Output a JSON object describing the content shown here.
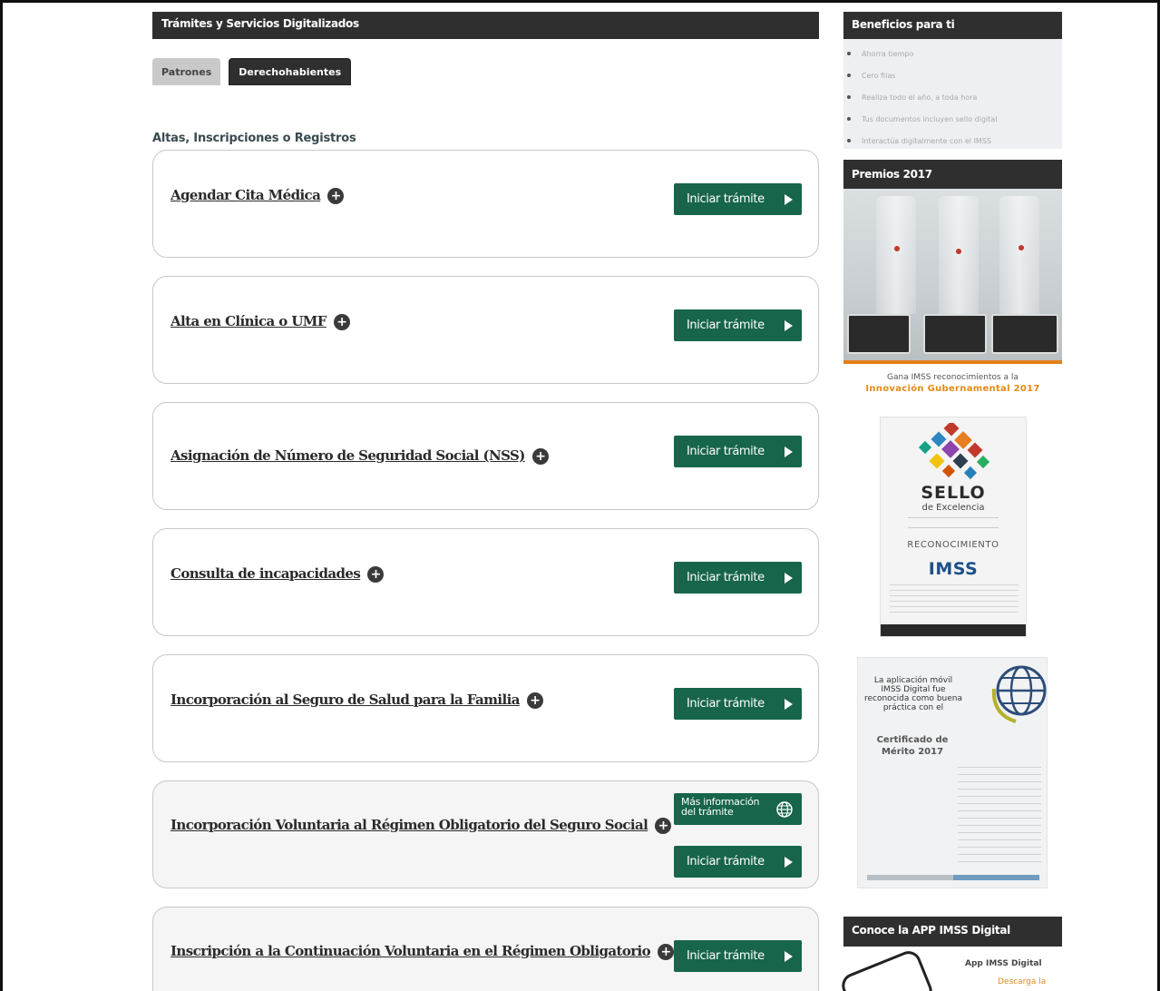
{
  "main": {
    "header": "Trámites y Servicios Digitalizados",
    "tabs": [
      {
        "label": "Patrones",
        "active": false
      },
      {
        "label": "Derechohabientes",
        "active": true
      }
    ],
    "section_title": "Altas, Inscripciones o Registros",
    "cards": [
      {
        "title": "Agendar Cita Médica",
        "button": "Iniciar trámite"
      },
      {
        "title": "Alta en Clínica o UMF",
        "button": "Iniciar trámite"
      },
      {
        "title": "Asignación de Número de Seguridad Social (NSS)",
        "button": "Iniciar trámite"
      },
      {
        "title": "Consulta de incapacidades",
        "button": "Iniciar trámite"
      },
      {
        "title": "Incorporación al Seguro de Salud para la Familia",
        "button": "Iniciar trámite"
      },
      {
        "title": "Incorporación Voluntaria al Régimen Obligatorio del Seguro Social",
        "info_button": "Más información del trámite",
        "button": "Iniciar trámite"
      },
      {
        "title": "Inscripción a la Continuación Voluntaria en el Régimen Obligatorio",
        "button": "Iniciar trámite"
      }
    ],
    "accent_color": "#17654a"
  },
  "sidebar": {
    "benefits_header": "Beneficios para ti",
    "benefits": [
      "Ahorra tiempo",
      "Cero filas",
      "Realiza todo el año, a toda hora",
      "Tus documentos incluyen sello digital",
      "Interactúa digitalmente con el IMSS"
    ],
    "awards_header": "Premios 2017",
    "awards_caption": "Gana IMSS reconocimientos a la",
    "awards_caption_highlight": "Innovación Gubernamental 2017",
    "sello_title": "SELLO",
    "sello_subtitle": "de Excelencia",
    "sello_recognition": "RECONOCIMIENTO",
    "sello_org": "IMSS",
    "cert_text": "La aplicación móvil IMSS Digital fue reconocida como buena práctica con el",
    "cert_title": "Certificado de Mérito 2017",
    "app_header": "Conoce la APP IMSS Digital",
    "app_name": "App IMSS Digital",
    "app_download": "Descarga la"
  }
}
